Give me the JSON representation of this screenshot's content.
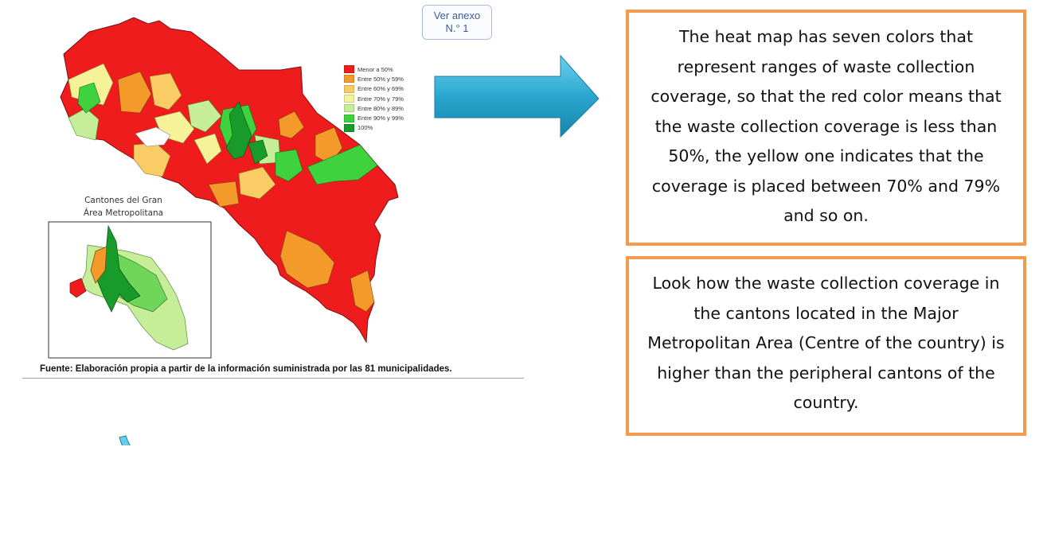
{
  "annex_button": {
    "line1": "Ver anexo",
    "line2": "N.° 1"
  },
  "legend": {
    "items": [
      {
        "label": "Menor a 50%",
        "color": "#ee1c1c"
      },
      {
        "label": "Entre 50% y 59%",
        "color": "#f39a2a"
      },
      {
        "label": "Entre 60% y 69%",
        "color": "#f9cc66"
      },
      {
        "label": "Entre 70% y 79%",
        "color": "#f6f29a"
      },
      {
        "label": "Entre 80% y 89%",
        "color": "#c6ee99"
      },
      {
        "label": "Entre 90% y 99%",
        "color": "#3ed33e"
      },
      {
        "label": "100%",
        "color": "#189b2a"
      }
    ]
  },
  "inset": {
    "title_line1": "Cantones del Gran",
    "title_line2": "Área Metropolitana"
  },
  "source": "Fuente: Elaboración propia a partir de la información suministrada por las 81 municipalidades.",
  "boxes": {
    "heatmap": "The heat map has seven colors that represent ranges of waste collection coverage, so that the red color means that the waste collection coverage is less than 50%, the yellow one indicates that the coverage is placed between 70% and 79% and so on.",
    "metro": "Look how the waste collection coverage in the cantons located in the Major Metropolitan Area (Centre of the country) is higher than the peripheral cantons of the country."
  },
  "colors": {
    "box_border": "#f29a4d",
    "arrow": "#2aa6cf"
  }
}
